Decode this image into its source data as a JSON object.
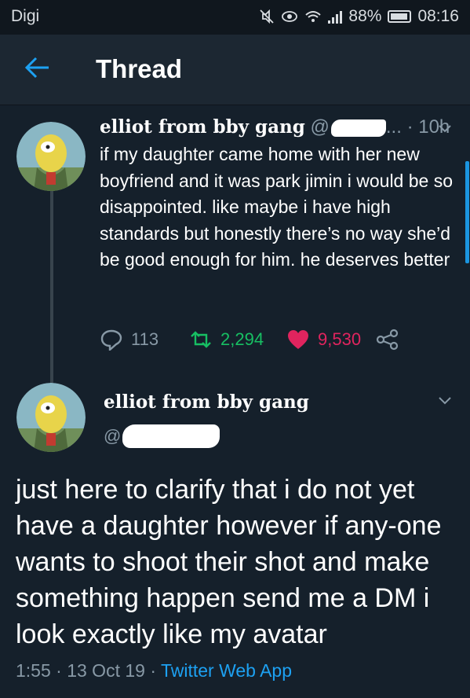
{
  "status_bar": {
    "carrier": "Digi",
    "battery": "88%",
    "time": "08:16"
  },
  "header": {
    "title": "Thread",
    "back_icon": "arrow-left-icon"
  },
  "tweet1": {
    "display_name": "elliot from bby gang",
    "handle_prefix": "@",
    "handle_suffix": "...",
    "time": "· 10h",
    "text": "if my daughter came home with her new boyfriend and it was park jimin i would be so disappointed. like maybe i have high standards but honestly there’s no way she’d be good enough for him. he deserves better",
    "replies": "113",
    "retweets": "2,294",
    "likes": "9,530"
  },
  "tweet2": {
    "display_name": "elliot from bby gang",
    "handle_prefix": "@",
    "text": "just here to clarify that i do not yet have a daughter however if any-one wants to shoot their shot and make something happen send me a DM i look exactly like my avatar",
    "meta": "1:55 · 13 Oct 19 · ",
    "source": "Twitter Web App"
  },
  "colors": {
    "background": "#15202b",
    "accent": "#1da1f2",
    "retweet": "#17bf63",
    "like": "#e0245e",
    "muted": "#8899a6"
  }
}
